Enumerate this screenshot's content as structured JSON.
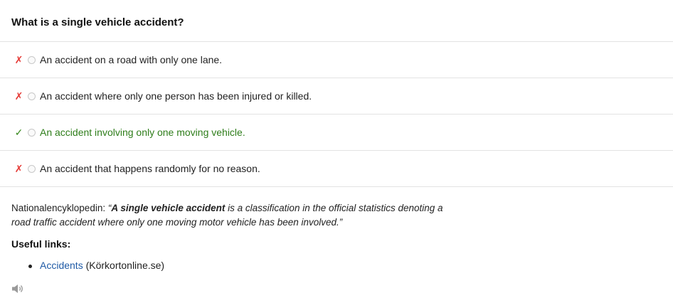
{
  "question": {
    "title": "What is a single vehicle accident?"
  },
  "answers": [
    {
      "mark": "✗",
      "status": "wrong",
      "text": "An accident on a road with only one lane."
    },
    {
      "mark": "✗",
      "status": "wrong",
      "text": "An accident where only one person has been injured or killed."
    },
    {
      "mark": "✓",
      "status": "correct",
      "text": "An accident involving only one moving vehicle."
    },
    {
      "mark": "✗",
      "status": "wrong",
      "text": "An accident that happens randomly for no reason."
    }
  ],
  "explanation": {
    "source": "Nationalencyklopedin: ",
    "quote_open": "“",
    "quote_bold": "A single vehicle accident",
    "quote_rest": " is a classification in the official statistics denoting a road traffic accident where only one moving motor vehicle has been involved.",
    "quote_close": "”"
  },
  "useful_links": {
    "heading": "Useful links:",
    "items": [
      {
        "link_text": "Accidents",
        "suffix": " (Körkortonline.se)"
      }
    ]
  },
  "icons": {
    "speaker": "speaker-icon"
  },
  "colors": {
    "wrong": "#e53935",
    "correct": "#2e7d1a",
    "link": "#1f5aa6"
  }
}
